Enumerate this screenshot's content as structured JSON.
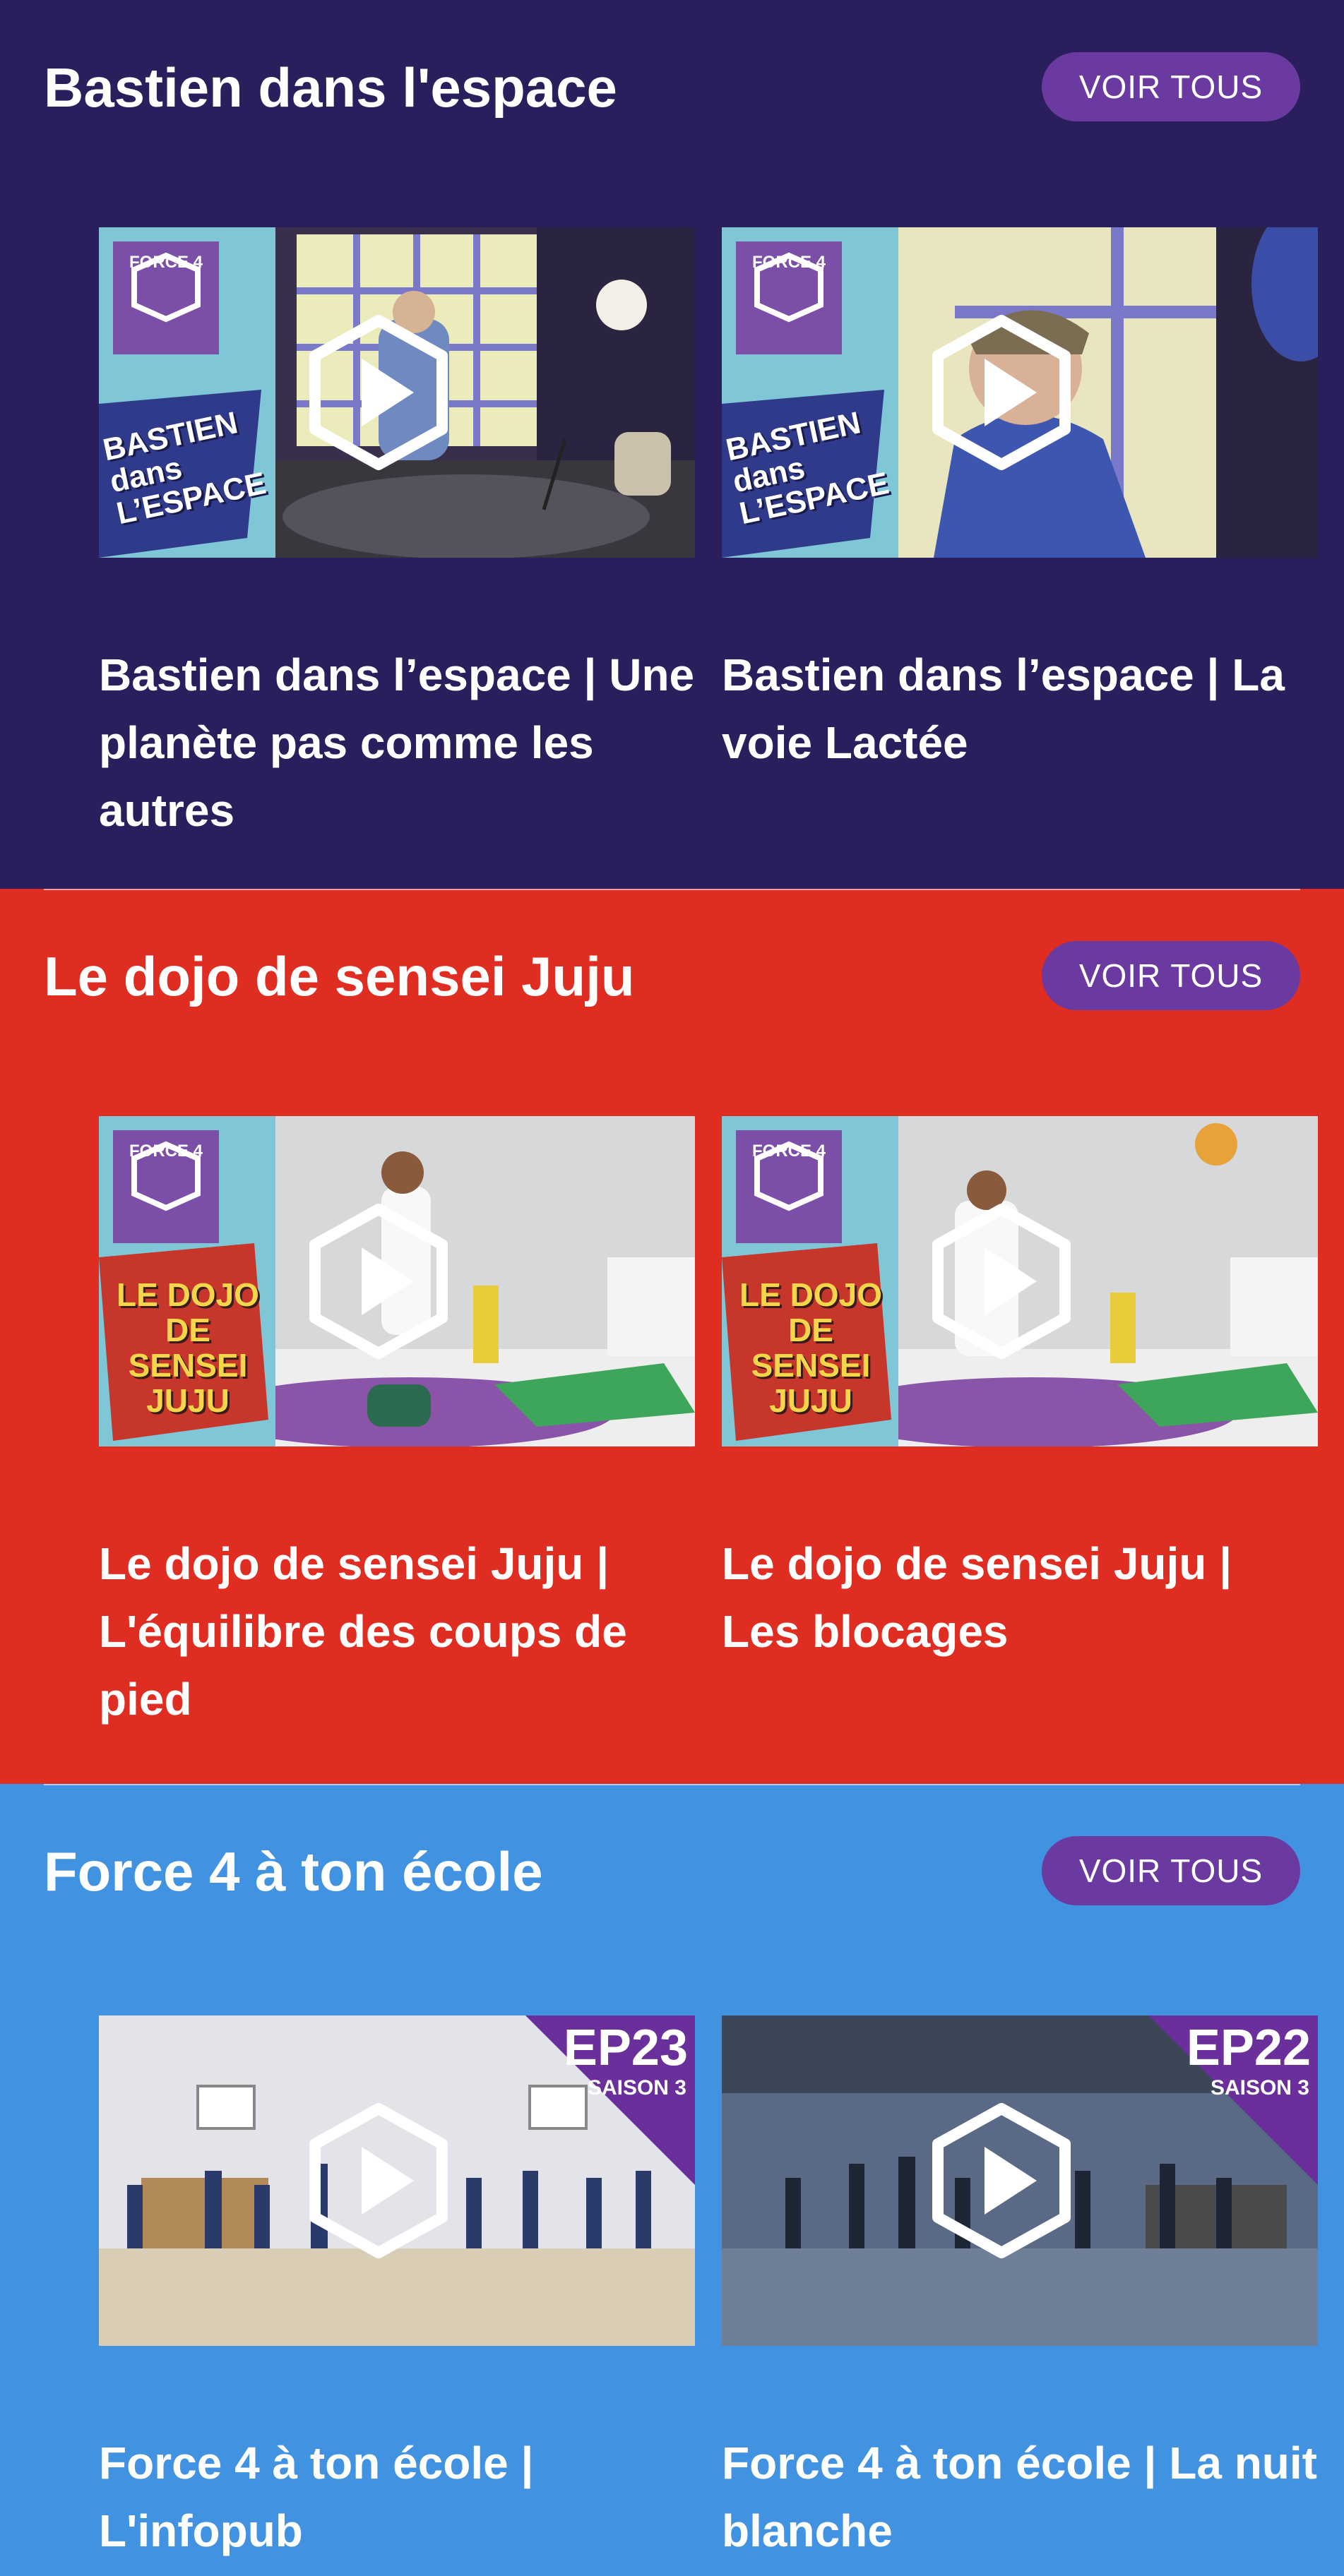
{
  "sections": [
    {
      "title": "Bastien dans l'espace",
      "button": "VOIR TOUS",
      "cards": [
        {
          "title": "Bastien dans l’espace | Une planète pas comme les autres",
          "logo": "BASTIEN dans L’ESPACE",
          "brand": "FORCE 4"
        },
        {
          "title": "Bastien dans l’espace | La voie Lactée",
          "logo": "BASTIEN dans L’ESPACE",
          "brand": "FORCE 4"
        }
      ]
    },
    {
      "title": "Le dojo de sensei Juju",
      "button": "VOIR TOUS",
      "cards": [
        {
          "title": "Le dojo de sensei Juju | L'équilibre des coups de pied",
          "logo": "LE DOJO DE SENSEI JUJU",
          "brand": "FORCE 4"
        },
        {
          "title": "Le dojo de sensei Juju | Les blocages",
          "logo": "LE DOJO DE SENSEI JUJU",
          "brand": "FORCE 4"
        }
      ]
    },
    {
      "title": "Force 4 à ton école",
      "button": "VOIR TOUS",
      "cards": [
        {
          "title": "Force 4 à ton école | L'infopub",
          "episode": "EP23",
          "season": "SAISON 3"
        },
        {
          "title": "Force 4 à ton école | La nuit blanche",
          "episode": "EP22",
          "season": "SAISON 3"
        }
      ]
    }
  ],
  "colors": {
    "section1_bg": "#2a1f5c",
    "section2_bg": "#e02d22",
    "section3_bg": "#4292e2",
    "button_bg": "#6b3aa0",
    "badge_bg": "#6a2f9a"
  },
  "icons": {
    "play": "play-hexagon-icon"
  }
}
